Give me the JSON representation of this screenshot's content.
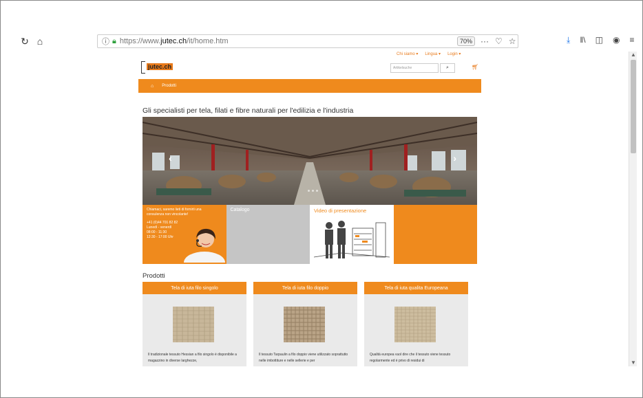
{
  "browser": {
    "reload_icon": "reload-icon",
    "home_icon": "home-icon",
    "url": {
      "proto": "https://www.",
      "host": "jutec.ch",
      "path": "/it/home.htm"
    },
    "zoom": "70%",
    "menu_dots": "···"
  },
  "site": {
    "top_links": [
      "Chi siamo ▾",
      "Lingua ▾",
      "Login ▾"
    ],
    "logo": {
      "text": "jutec.ch"
    },
    "search": {
      "placeholder": "Artikelsuche"
    },
    "nav": {
      "item": "Prodotti"
    },
    "headline": "Gli specialisti per tela, filati e fibre naturali per l'edilizia e l'industria",
    "tiles": {
      "contact": {
        "line1": "Chiamaci, saremo lieti di fornirti una consulenza non vincolante!",
        "phone": "+41 (0)44 701 82 82",
        "days": "Lunedì - venerdì",
        "hours1": "08:00 - 11:30",
        "hours2": "12:30 - 17:00 Uhr"
      },
      "catalog": "Catalogo",
      "video": "Video di presentazione"
    },
    "products_title": "Prodotti",
    "products": [
      {
        "title": "Tela di iuta filo singolo",
        "text": "Il tradizionale tessuto Hessian a filo singolo è disponibile a magazzino in diverse larghezze,"
      },
      {
        "title": "Tela di iuta filo doppio",
        "text": "Il tessuto Tarpaulin a filo doppio viene utilizzato soprattutto nelle imbottiture e nelle sellerie e per"
      },
      {
        "title": "Tela di iuta qualita Europeana",
        "text": "Qualità europea vuol dire che il tessuto viene tessuto regolarmente ed è privo di residui di"
      }
    ]
  },
  "colors": {
    "accent": "#ef8a1d",
    "tile_gray": "#c5c5c5",
    "card_bg": "#eaeaea"
  }
}
